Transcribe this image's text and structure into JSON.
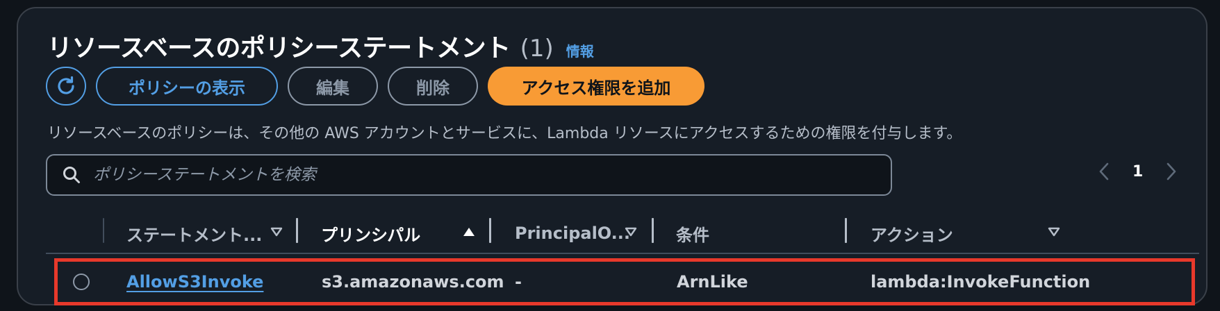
{
  "header": {
    "title": "リソースベースのポリシーステートメント",
    "count": "(1)",
    "info_link": "情報"
  },
  "toolbar": {
    "refresh_icon": "refresh-icon",
    "view_policy_label": "ポリシーの表示",
    "edit_label": "編集",
    "delete_label": "削除",
    "add_permission_label": "アクセス権限を追加"
  },
  "description": "リソースベースのポリシーは、その他の AWS アカウントとサービスに、Lambda リソースにアクセスするための権限を付与します。",
  "search": {
    "placeholder": "ポリシーステートメントを検索",
    "value": ""
  },
  "pagination": {
    "current_page": "1"
  },
  "table": {
    "columns": [
      {
        "label": "ステートメント...",
        "sort": "none"
      },
      {
        "label": "プリンシパル",
        "sort": "ascending"
      },
      {
        "label": "PrincipalO...",
        "sort": "none"
      },
      {
        "label": "条件",
        "sort": "none"
      },
      {
        "label": "アクション",
        "sort": "none"
      }
    ],
    "rows": [
      {
        "statement_id": "AllowS3Invoke",
        "principal": "s3.amazonaws.com",
        "principal_org": "-",
        "condition": "ArnLike",
        "action": "lambda:InvokeFunction",
        "selected": false
      }
    ]
  },
  "colors": {
    "accent_blue": "#539fe5",
    "primary_orange": "#f89b35",
    "highlight_red": "#e8392b",
    "background": "#0f141a",
    "panel": "#161d26"
  }
}
